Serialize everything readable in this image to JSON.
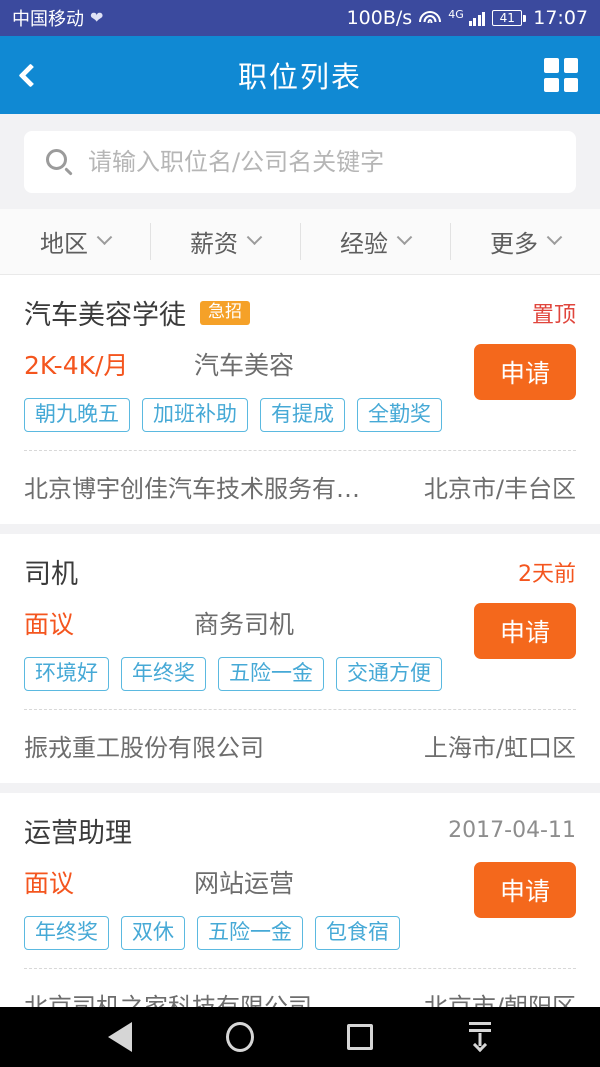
{
  "status_bar": {
    "carrier": "中国移动",
    "heart_icon": "heart-pulse-icon",
    "network_speed": "100B/s",
    "wifi_icon": "wifi-icon",
    "network_type": "4G",
    "signal_icon": "signal-bars-icon",
    "battery_level": "41",
    "time": "17:07"
  },
  "header": {
    "back_icon": "chevron-left-icon",
    "title": "职位列表",
    "grid_icon": "grid-view-icon"
  },
  "search": {
    "icon": "search-icon",
    "value": "",
    "placeholder": "请输入职位名/公司名关键字"
  },
  "filters": [
    {
      "label": "地区",
      "icon": "chevron-down-icon"
    },
    {
      "label": "薪资",
      "icon": "chevron-down-icon"
    },
    {
      "label": "经验",
      "icon": "chevron-down-icon"
    },
    {
      "label": "更多",
      "icon": "chevron-down-icon"
    }
  ],
  "jobs": [
    {
      "title": "汽车美容学徒",
      "badge": "急招",
      "meta": "置顶",
      "meta_style": "pin",
      "salary": "2K-4K/月",
      "category": "汽车美容",
      "apply_label": "申请",
      "tags": [
        "朝九晚五",
        "加班补助",
        "有提成",
        "全勤奖"
      ],
      "company": "北京博宇创佳汽车技术服务有…",
      "location": "北京市/丰台区"
    },
    {
      "title": "司机",
      "badge": "",
      "meta": "2天前",
      "meta_style": "hot",
      "salary": "面议",
      "category": "商务司机",
      "apply_label": "申请",
      "tags": [
        "环境好",
        "年终奖",
        "五险一金",
        "交通方便"
      ],
      "company": "振戎重工股份有限公司",
      "location": "上海市/虹口区"
    },
    {
      "title": "运营助理",
      "badge": "",
      "meta": "2017-04-11",
      "meta_style": "plain",
      "salary": "面议",
      "category": "网站运营",
      "apply_label": "申请",
      "tags": [
        "年终奖",
        "双休",
        "五险一金",
        "包食宿"
      ],
      "company": "北京司机之家科技有限公司",
      "location": "北京市/朝阳区"
    }
  ],
  "nav_bar": {
    "back_icon": "nav-back-icon",
    "home_icon": "nav-home-icon",
    "recents_icon": "nav-recents-icon",
    "hide_icon": "nav-hide-keyboard-icon"
  },
  "colors": {
    "status_bar_bg": "#3b4a9e",
    "header_bg": "#1089d3",
    "accent_orange": "#f4681c",
    "badge_orange": "#f5a128",
    "salary_orange": "#f4551e",
    "pin_red": "#e0453c",
    "tag_blue": "#46a9d6",
    "page_bg": "#f2f2f4"
  }
}
